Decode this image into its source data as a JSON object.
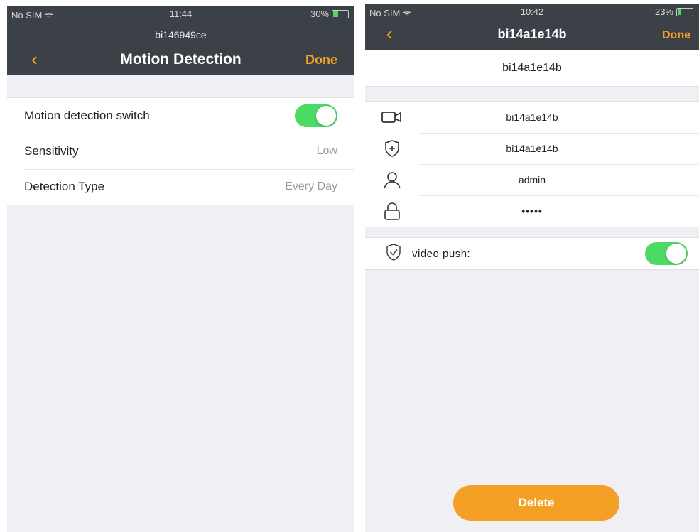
{
  "left": {
    "status": {
      "carrier": "No SIM",
      "time": "11:44",
      "battery": "30%",
      "battery_level": 0.3
    },
    "subtitle": "bi146949ce",
    "title": "Motion Detection",
    "back_icon": "chevron-left-icon",
    "done": "Done",
    "rows": [
      {
        "label": "Motion detection switch",
        "toggle": true
      },
      {
        "label": "Sensitivity",
        "value": "Low"
      },
      {
        "label": "Detection Type",
        "value": "Every Day"
      }
    ]
  },
  "right": {
    "status": {
      "carrier": "No SIM",
      "time": "10:42",
      "battery": "23%",
      "battery_level": 0.23
    },
    "title": "bi14a1e14b",
    "back_icon": "chevron-left-icon",
    "done": "Done",
    "device_name": "bi14a1e14b",
    "info_rows": [
      {
        "icon": "camera-icon",
        "value": "bi14a1e14b"
      },
      {
        "icon": "shield-plus-icon",
        "value": "bi14a1e14b"
      },
      {
        "icon": "user-icon",
        "value": "admin"
      },
      {
        "icon": "lock-icon",
        "value": "•••••"
      }
    ],
    "push": {
      "icon": "shield-check-icon",
      "label": "video push:",
      "toggle": true
    },
    "delete": "Delete"
  },
  "colors": {
    "accent": "#f3a024",
    "toggle_on": "#4cd964",
    "nav_bg": "#3c4047",
    "page_bg": "#efeff4"
  }
}
